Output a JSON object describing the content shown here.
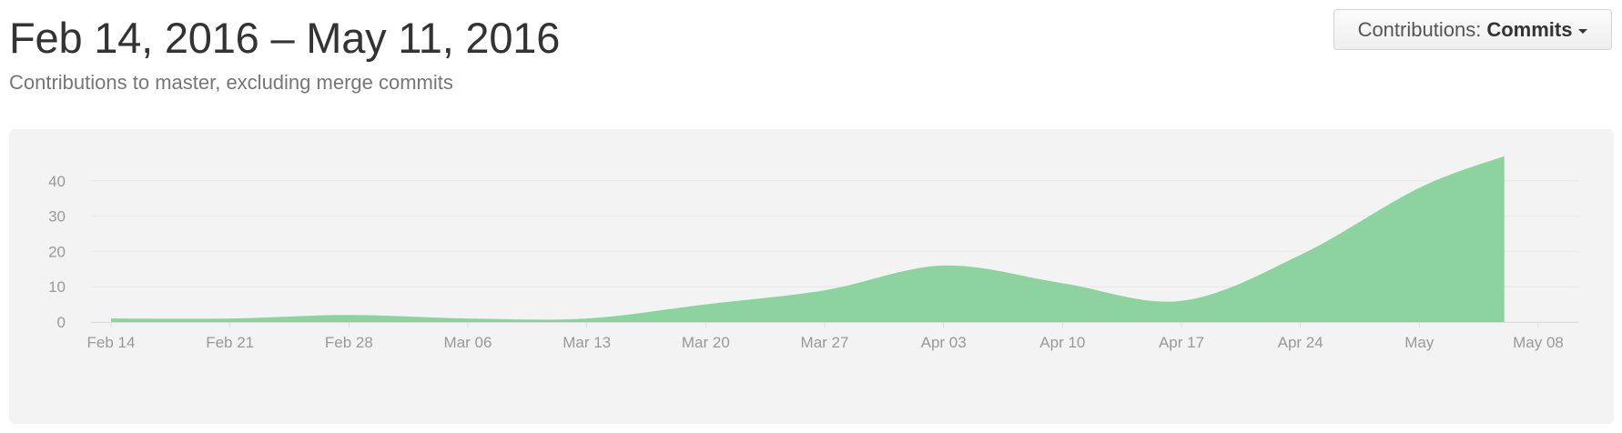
{
  "header": {
    "title": "Feb 14, 2016 – May 11, 2016",
    "subtitle": "Contributions to master, excluding merge commits"
  },
  "contributions_dropdown": {
    "label": "Contributions:",
    "selected": "Commits",
    "icon": "caret-down-icon"
  },
  "colors": {
    "area_fill": "#8cd3a0",
    "panel_background": "#f3f3f3",
    "grid": "#e8e8e8",
    "tick_text": "#999999"
  },
  "chart_data": {
    "type": "area",
    "title": "",
    "xlabel": "",
    "ylabel": "",
    "x_type": "date",
    "xlim": [
      "2016-02-14",
      "2016-05-11"
    ],
    "ylim": [
      0,
      50
    ],
    "y_ticks": [
      0,
      10,
      20,
      30,
      40
    ],
    "x_ticks": [
      {
        "date": "2016-02-14",
        "label": "Feb 14"
      },
      {
        "date": "2016-02-21",
        "label": "Feb 21"
      },
      {
        "date": "2016-02-28",
        "label": "Feb 28"
      },
      {
        "date": "2016-03-06",
        "label": "Mar 06"
      },
      {
        "date": "2016-03-13",
        "label": "Mar 13"
      },
      {
        "date": "2016-03-20",
        "label": "Mar 20"
      },
      {
        "date": "2016-03-27",
        "label": "Mar 27"
      },
      {
        "date": "2016-04-03",
        "label": "Apr 03"
      },
      {
        "date": "2016-04-10",
        "label": "Apr 10"
      },
      {
        "date": "2016-04-17",
        "label": "Apr 17"
      },
      {
        "date": "2016-04-24",
        "label": "Apr 24"
      },
      {
        "date": "2016-05-01",
        "label": "May"
      },
      {
        "date": "2016-05-08",
        "label": "May 08"
      }
    ],
    "grid": true,
    "legend": "none",
    "series": [
      {
        "x": [
          "2016-02-14",
          "2016-02-21",
          "2016-02-28",
          "2016-03-06",
          "2016-03-13",
          "2016-03-20",
          "2016-03-27",
          "2016-04-03",
          "2016-04-10",
          "2016-04-17",
          "2016-04-24",
          "2016-05-01",
          "2016-05-06"
        ],
        "values": [
          1,
          1,
          2,
          1,
          1,
          5,
          9,
          16,
          11,
          6,
          19,
          38,
          47
        ]
      }
    ]
  }
}
